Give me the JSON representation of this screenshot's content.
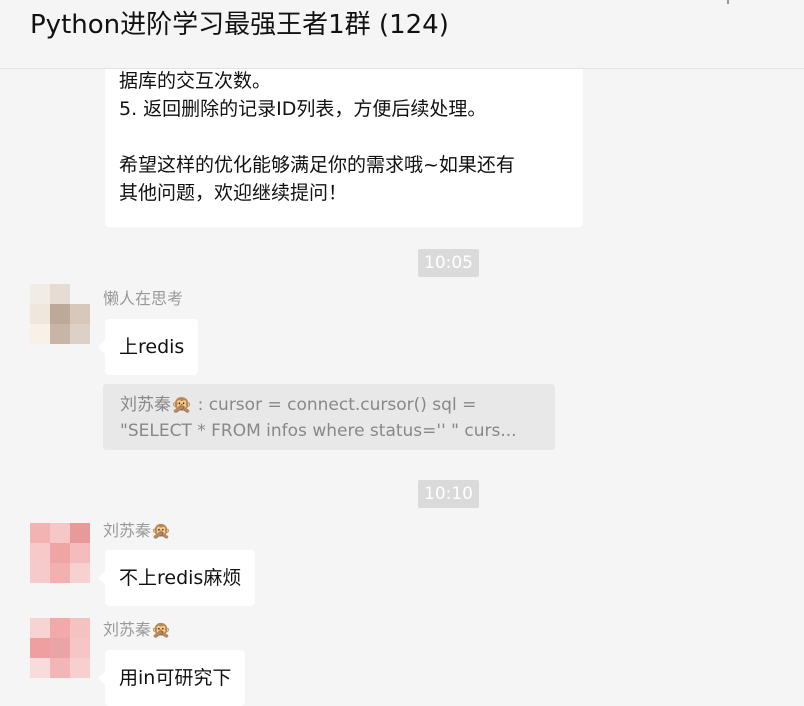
{
  "header": {
    "title": "Python进阶学习最强王者1群 (124)"
  },
  "previous_message": {
    "lines": [
      "据库的交互次数。",
      "5. 返回删除的记录ID列表，方便后续处理。",
      "",
      "希望这样的优化能够满足你的需求哦~如果还有",
      "其他问题，欢迎继续提问！"
    ]
  },
  "timestamps": [
    "10:05",
    "10:10"
  ],
  "messages": [
    {
      "sender": "懒人在思考",
      "text": "上redis"
    },
    {
      "sender": "刘苏秦🙊",
      "text": "不上redis麻烦"
    },
    {
      "sender": "刘苏秦🙊",
      "text": "用in可研究下"
    }
  ],
  "quote": {
    "line1": "刘苏秦🙊 : cursor = connect.cursor()      sql =",
    "line2": "\"SELECT * FROM infos where status='' \"    curs..."
  },
  "icons": {
    "monkey": "see-no-evil-monkey-icon",
    "avatar": "blurred-avatar"
  }
}
